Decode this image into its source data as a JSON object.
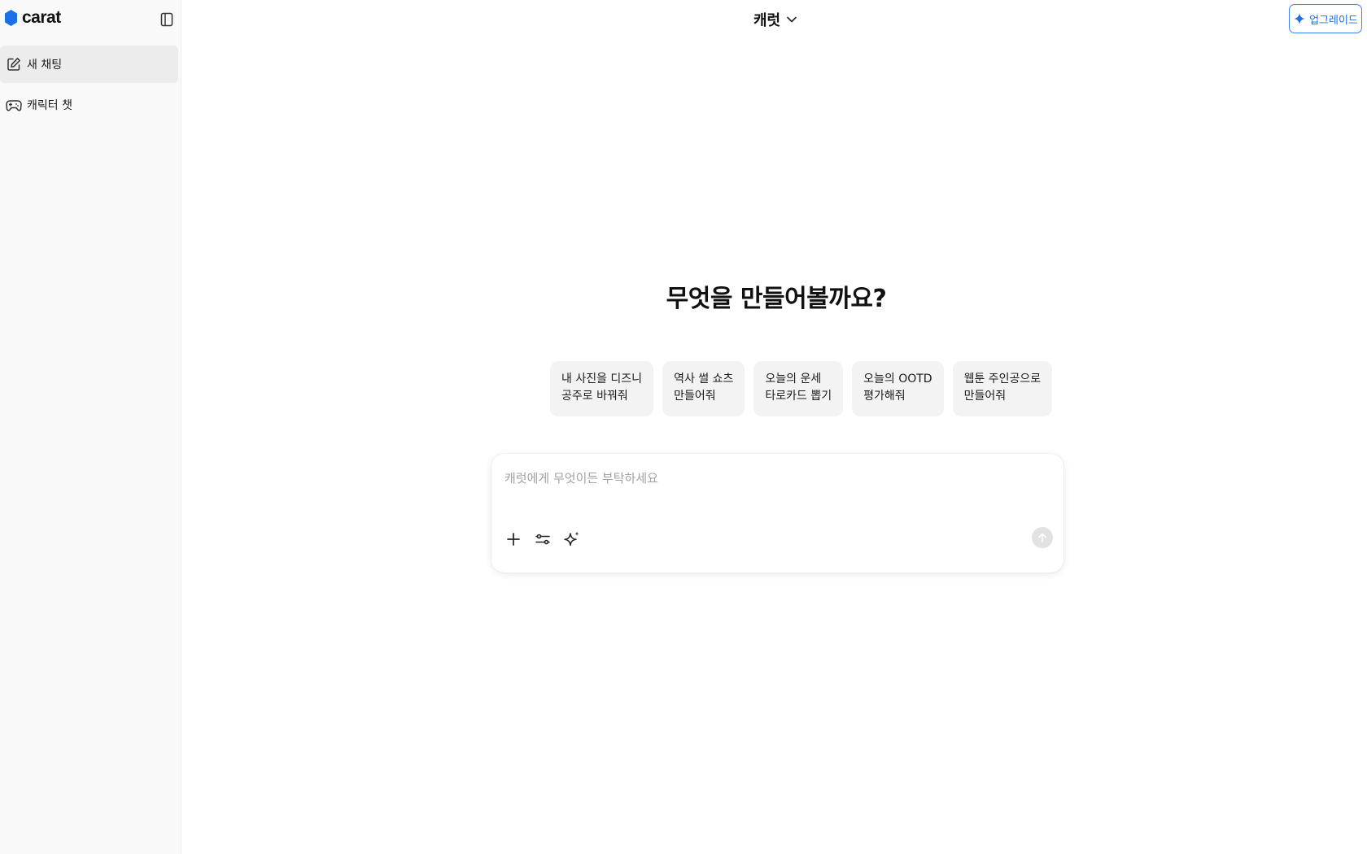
{
  "sidebar": {
    "logo_text": "carat",
    "items": [
      {
        "label": "새 채팅",
        "icon": "edit-icon",
        "active": true
      },
      {
        "label": "캐릭터 챗",
        "icon": "gamepad-icon",
        "active": false
      }
    ]
  },
  "header": {
    "model_name": "캐럿",
    "upgrade_label": "업그레이드"
  },
  "main": {
    "title": "무엇을 만들어볼까요?",
    "suggestions": [
      {
        "line1": "내 사진을 디즈니",
        "line2": "공주로 바꿔줘"
      },
      {
        "line1": "역사 썰 쇼츠",
        "line2": "만들어줘"
      },
      {
        "line1": "오늘의 운세",
        "line2": "타로카드 뽑기"
      },
      {
        "line1": "오늘의 OOTD",
        "line2": "평가해줘"
      },
      {
        "line1": "웹툰 주인공으로",
        "line2": "만들어줘"
      }
    ],
    "composer": {
      "placeholder": "캐럿에게 무엇이든 부탁하세요",
      "value": ""
    }
  },
  "colors": {
    "brand": "#1d6fe8",
    "sidebar_bg": "#f9f9f9",
    "chip_bg": "#f3f3f3"
  }
}
